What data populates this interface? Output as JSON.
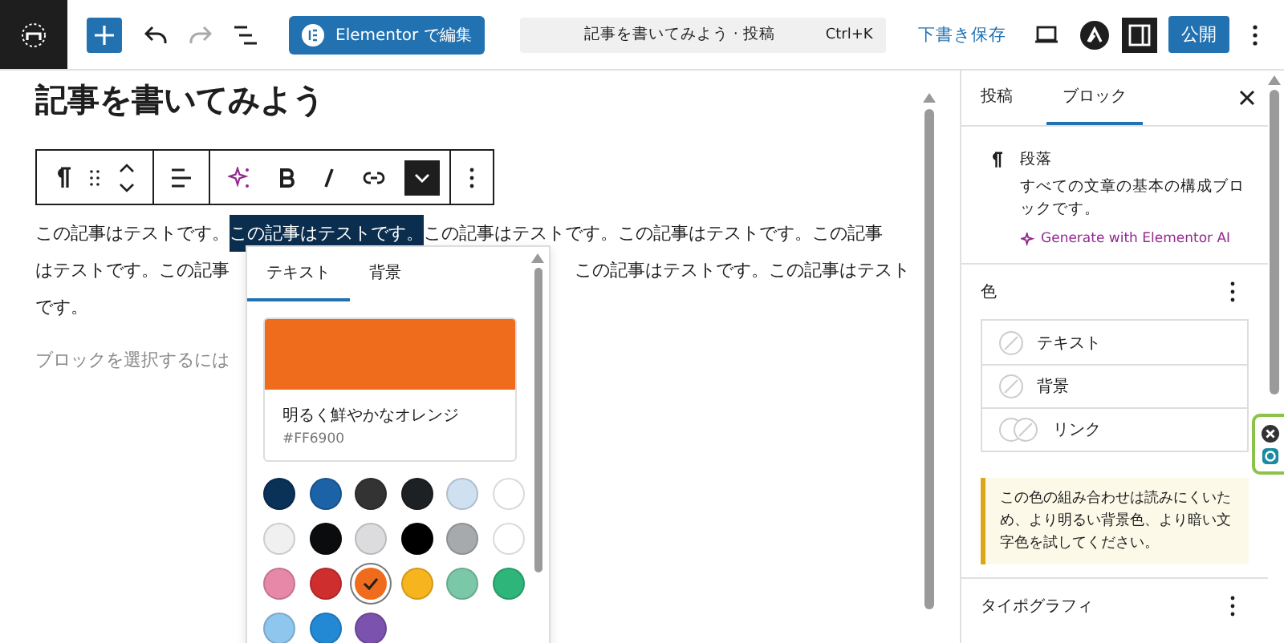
{
  "header": {
    "redo": {
      "disabled": true
    },
    "elementor_button": "Elementor で編集",
    "command_bar": {
      "title": "記事を書いてみよう · 投稿",
      "shortcut": "Ctrl+K"
    },
    "save_draft": "下書き保存",
    "settings_toggle": {
      "on": true
    },
    "publish": "公開"
  },
  "editor": {
    "title": "記事を書いてみよう",
    "format_dropdown": {
      "on": true
    },
    "lines": [
      {
        "kind": "flow",
        "segments": [
          {
            "text": "この記事はテストです。",
            "selected": false
          },
          {
            "text": "この記事はテストです。",
            "selected": true
          },
          {
            "text": "この記事はテストです。この記事はテストです。この記事",
            "selected": false
          }
        ]
      },
      {
        "kind": "split",
        "segments": [
          {
            "text": "はテストです。この記事",
            "selected": false
          },
          {
            "text": "この記事はテストです。この記事はテスト",
            "selected": false
          }
        ]
      },
      {
        "kind": "flow",
        "segments": [
          {
            "text": "です。",
            "selected": false
          }
        ]
      }
    ],
    "placeholder": "ブロックを選択するには"
  },
  "color_popover": {
    "tabs": [
      {
        "label": "テキスト",
        "selected": true
      },
      {
        "label": "背景",
        "selected": false
      }
    ],
    "current": {
      "color": "#ee6c1b",
      "name": "明るく鮮やかなオレンジ",
      "code": "#FF6900"
    },
    "swatches": [
      {
        "color": "#0a3157",
        "selected": false
      },
      {
        "color": "#1b62a6",
        "selected": false
      },
      {
        "color": "#333333",
        "selected": false
      },
      {
        "color": "#1e2124",
        "selected": false
      },
      {
        "color": "#cfe0f1",
        "selected": false
      },
      {
        "color": "#ffffff",
        "selected": false
      },
      {
        "color": "#f0f0f1",
        "selected": false
      },
      {
        "color": "#0b0c0e",
        "selected": false
      },
      {
        "color": "#dcdcde",
        "selected": false
      },
      {
        "color": "#000000",
        "selected": false
      },
      {
        "color": "#a7aaad",
        "selected": false
      },
      {
        "color": "#ffffff",
        "selected": false
      },
      {
        "color": "#e888a8",
        "selected": false
      },
      {
        "color": "#cf2e2e",
        "selected": false
      },
      {
        "color": "#ee6c1b",
        "selected": true
      },
      {
        "color": "#f6b51e",
        "selected": false
      },
      {
        "color": "#7bc8a8",
        "selected": false
      },
      {
        "color": "#2eb57a",
        "selected": false
      },
      {
        "color": "#8ec6ee",
        "selected": false
      },
      {
        "color": "#2489d4",
        "selected": false
      },
      {
        "color": "#7b52ad",
        "selected": false
      }
    ]
  },
  "sidebar": {
    "tabs": [
      {
        "label": "投稿",
        "selected": false
      },
      {
        "label": "ブロック",
        "selected": true
      }
    ],
    "block": {
      "name": "段落",
      "description": "すべての文章の基本の構成ブロックです。",
      "ai_link": "Generate with Elementor AI"
    },
    "color_panel": {
      "title": "色",
      "items": [
        {
          "label": "テキスト",
          "kind": "single"
        },
        {
          "label": "背景",
          "kind": "single"
        },
        {
          "label": "リンク",
          "kind": "double"
        }
      ],
      "notice": "この色の組み合わせは読みにくいため、より明るい背景色、より暗い文字色を試してください。"
    },
    "typography": {
      "title": "タイポグラフィ"
    }
  }
}
